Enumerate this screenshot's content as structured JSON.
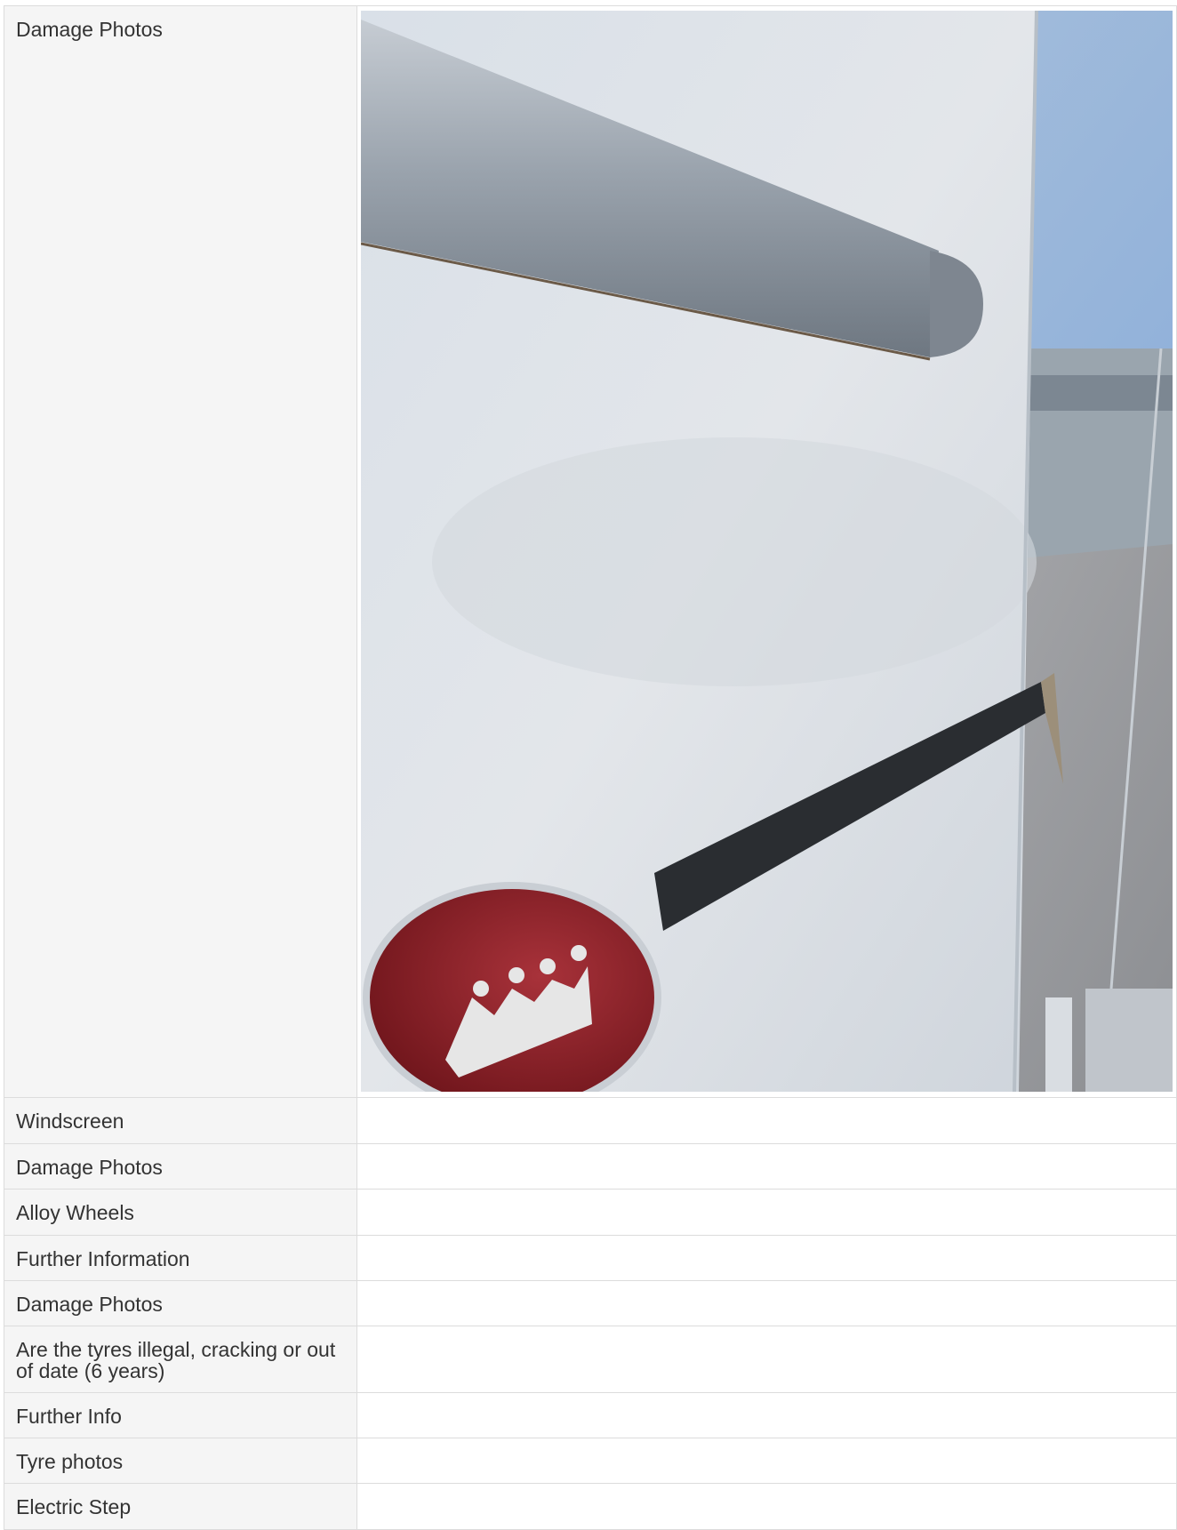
{
  "rows": [
    {
      "label": "Damage Photos",
      "has_photo": true
    },
    {
      "label": "Windscreen"
    },
    {
      "label": "Damage Photos"
    },
    {
      "label": "Alloy Wheels"
    },
    {
      "label": "Further Information"
    },
    {
      "label": "Damage Photos"
    },
    {
      "label": "Are the tyres illegal, cracking or out of date (6 years)"
    },
    {
      "label": "Further Info"
    },
    {
      "label": "Tyre photos"
    },
    {
      "label": "Electric Step"
    }
  ],
  "colors": {
    "label_bg": "#f5f5f5",
    "border": "#dcdcdc",
    "text": "#333333",
    "badge_red": "#8f1c24"
  }
}
